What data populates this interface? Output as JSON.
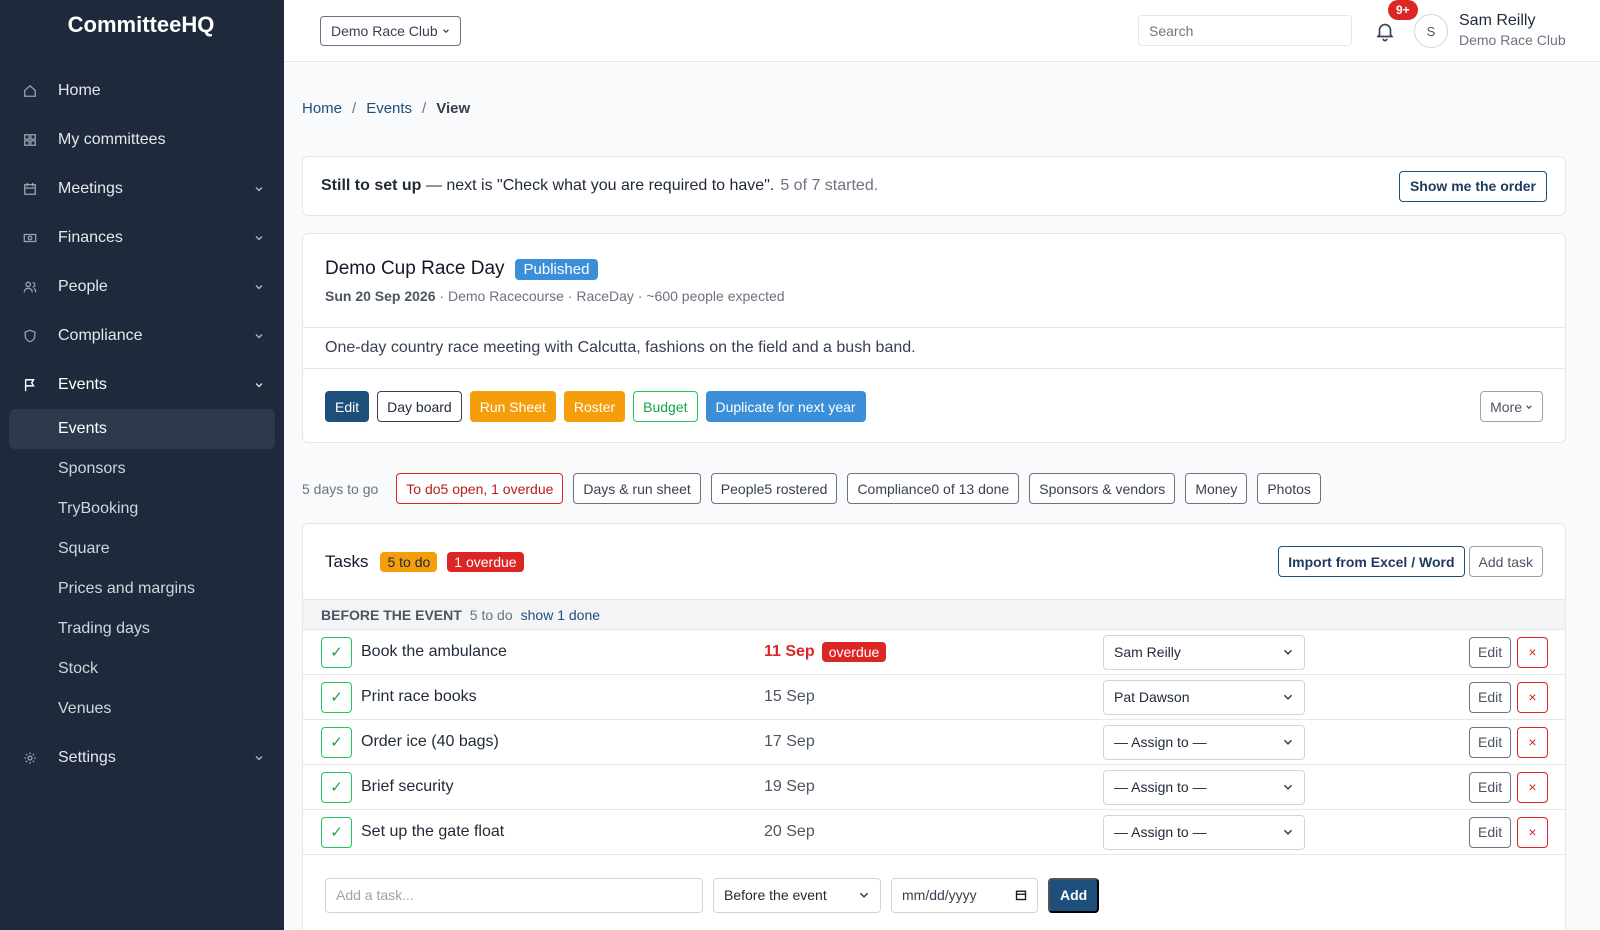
{
  "app": {
    "brand": "CommitteeHQ"
  },
  "sidebar": {
    "items": [
      {
        "label": "Home",
        "icon": "home-icon",
        "has_children": false
      },
      {
        "label": "My committees",
        "icon": "grid-icon",
        "has_children": false
      },
      {
        "label": "Meetings",
        "icon": "calendar-icon",
        "has_children": true
      },
      {
        "label": "Finances",
        "icon": "money-icon",
        "has_children": true
      },
      {
        "label": "People",
        "icon": "people-icon",
        "has_children": true
      },
      {
        "label": "Compliance",
        "icon": "shield-icon",
        "has_children": true
      },
      {
        "label": "Events",
        "icon": "flag-icon",
        "has_children": true,
        "expanded": true
      }
    ],
    "events_sub": [
      "Events",
      "Sponsors",
      "TryBooking",
      "Square",
      "Prices and margins",
      "Trading days",
      "Stock",
      "Venues"
    ],
    "settings": {
      "label": "Settings",
      "icon": "gear-icon"
    }
  },
  "topbar": {
    "club_select": "Demo Race Club",
    "search_placeholder": "Search",
    "notifications": "9+",
    "avatar_initial": "S",
    "user_name": "Sam Reilly",
    "user_club": "Demo Race Club"
  },
  "breadcrumb": {
    "home": "Home",
    "events": "Events",
    "current": "View"
  },
  "setup": {
    "lead": "Still to set up",
    "text": " — next is \"Check what you are required to have\".",
    "progress": "5 of 7 started.",
    "button": "Show me the order"
  },
  "event": {
    "title": "Demo Cup Race Day",
    "status": "Published",
    "date": "Sun 20 Sep 2026",
    "meta": " · Demo Racecourse · RaceDay · ~600 people expected",
    "description": "One-day country race meeting with Calcutta, fashions on the field and a bush band.",
    "actions": {
      "edit": "Edit",
      "day_board": "Day board",
      "run_sheet": "Run Sheet",
      "roster": "Roster",
      "budget": "Budget",
      "duplicate": "Duplicate for next year",
      "more": "More"
    }
  },
  "tabs": {
    "countdown": "5 days to go",
    "todo_label": "To do",
    "todo_value": "5 open, 1 overdue",
    "days": "Days & run sheet",
    "people_label": "People",
    "people_value": "5 rostered",
    "compliance_label": "Compliance",
    "compliance_value": "0 of 13 done",
    "sponsors": "Sponsors & vendors",
    "money": "Money",
    "photos": "Photos"
  },
  "tasks": {
    "title": "Tasks",
    "todo_badge": "5 to do",
    "overdue_badge": "1 overdue",
    "import_button": "Import from Excel / Word",
    "add_button": "Add task",
    "section": {
      "name": "BEFORE THE EVENT",
      "count": "5 to do",
      "show_done": "show 1 done"
    },
    "rows": [
      {
        "name": "Book the ambulance",
        "due": "11 Sep",
        "overdue": "overdue",
        "assignee": "Sam Reilly"
      },
      {
        "name": "Print race books",
        "due": "15 Sep",
        "assignee": "Pat Dawson"
      },
      {
        "name": "Order ice (40 bags)",
        "due": "17 Sep",
        "assignee": "— Assign to —"
      },
      {
        "name": "Brief security",
        "due": "19 Sep",
        "assignee": "— Assign to —"
      },
      {
        "name": "Set up the gate float",
        "due": "20 Sep",
        "assignee": "— Assign to —"
      }
    ],
    "row_edit": "Edit",
    "row_delete": "×",
    "add_form": {
      "placeholder": "Add a task...",
      "phase": "Before the event",
      "date_placeholder": "mm/dd/yyyy",
      "submit": "Add"
    }
  }
}
